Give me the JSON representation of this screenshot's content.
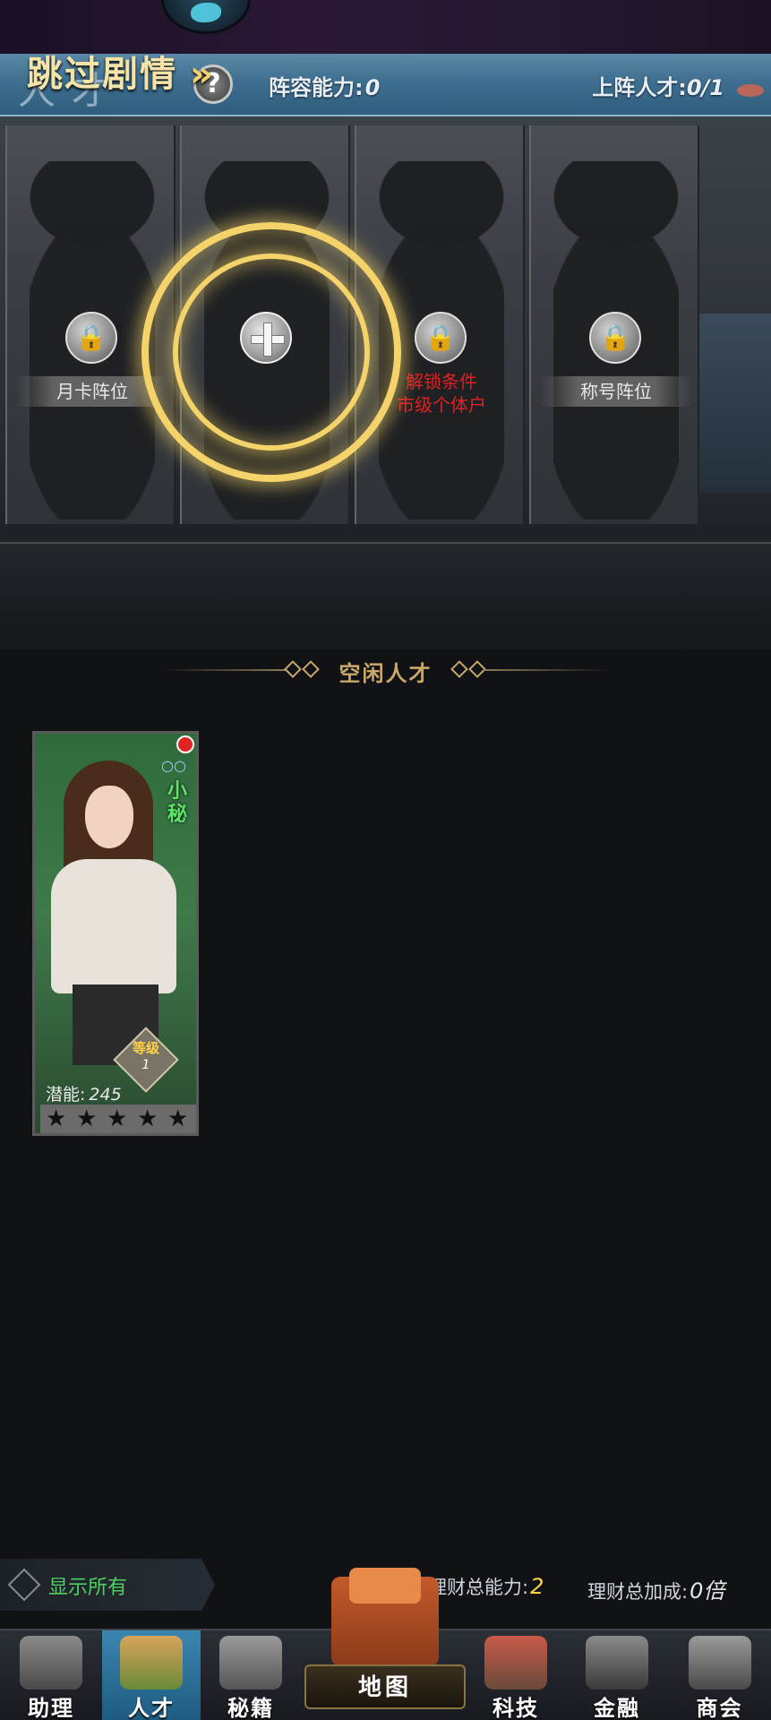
{
  "header": {
    "title": "人才",
    "help_label": "?",
    "skip_story": "跳过剧情",
    "skip_chevron": "»",
    "lineup_ability_label": "阵容能力:",
    "lineup_ability_value": "0",
    "onteam_label": "上阵人才:",
    "onteam_value": "0/1"
  },
  "slots": [
    {
      "state": "locked",
      "label": "月卡阵位",
      "icon": "lock-icon"
    },
    {
      "state": "open",
      "label": "",
      "icon": "plus-icon"
    },
    {
      "state": "locked",
      "unlock_line1": "解锁条件",
      "unlock_line2": "市级个体户",
      "icon": "lock-icon",
      "unlock_color": "#e32020"
    },
    {
      "state": "locked",
      "label": "称号阵位",
      "icon": "lock-icon"
    }
  ],
  "idle_section": {
    "title": "空闲人才"
  },
  "talent_card": {
    "role": "小秘",
    "level_label": "等级",
    "level_value": "1",
    "potential_label": "潜能:",
    "potential_value": "245",
    "stars": 5,
    "notification": true
  },
  "info_bar": {
    "show_all": "显示所有",
    "fin_total_label": "理财总能力:",
    "fin_total_value": "2",
    "fin_bonus_label": "理财总加成:",
    "fin_bonus_value": "0倍"
  },
  "nav": {
    "items": [
      {
        "label": "助理",
        "icon": "assistant-icon"
      },
      {
        "label": "人才",
        "icon": "talent-icon",
        "active": true
      },
      {
        "label": "秘籍",
        "icon": "secret-book-icon"
      },
      {
        "label": "地图",
        "icon": "map-icon"
      },
      {
        "label": "科技",
        "icon": "tech-icon"
      },
      {
        "label": "金融",
        "icon": "finance-icon"
      },
      {
        "label": "商会",
        "icon": "chamber-icon"
      }
    ]
  },
  "colors": {
    "header_blue": "#3f6f90",
    "glow_gold": "#f3d36a",
    "unlock_red": "#e32020",
    "show_all_green": "#4fcf5f",
    "value_gold": "#ffd24a",
    "active_nav": "#3a86b0"
  }
}
